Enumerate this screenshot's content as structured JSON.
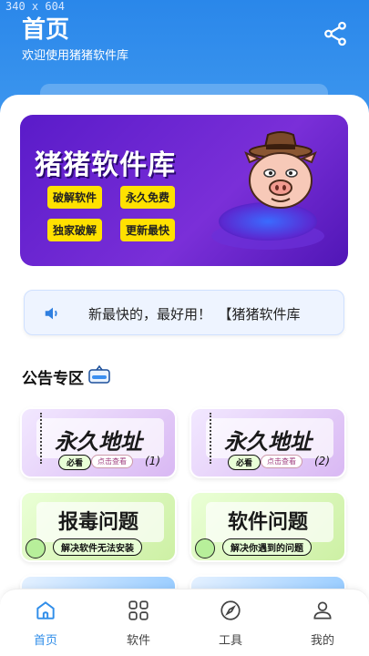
{
  "debug_overlay": "340 x 604",
  "header": {
    "title": "首页",
    "subtitle": "欢迎使用猪猪软件库"
  },
  "banner": {
    "title": "猪猪软件库",
    "tags": [
      "破解软件",
      "永久免费",
      "独家破解",
      "更新最快"
    ]
  },
  "notice": {
    "text": "新最快的，最好用！　【猪猪软件库"
  },
  "section": {
    "title": "公告专区"
  },
  "cards": [
    {
      "title": "永久地址",
      "bar": "必看",
      "pill": "点击查看",
      "num": "(1)"
    },
    {
      "title": "永久地址",
      "bar": "必看",
      "pill": "点击查看",
      "num": "(2)"
    },
    {
      "title": "报毒问题",
      "bar": "解决软件无法安装"
    },
    {
      "title": "软件问题",
      "bar": "解决你遇到的问题"
    }
  ],
  "tabs": [
    {
      "label": "首页",
      "icon": "home-icon"
    },
    {
      "label": "软件",
      "icon": "grid-icon"
    },
    {
      "label": "工具",
      "icon": "compass-icon"
    },
    {
      "label": "我的",
      "icon": "user-icon"
    }
  ],
  "colors": {
    "primary": "#2f8de9",
    "banner": "#6a25d0",
    "tag": "#ffe100"
  }
}
